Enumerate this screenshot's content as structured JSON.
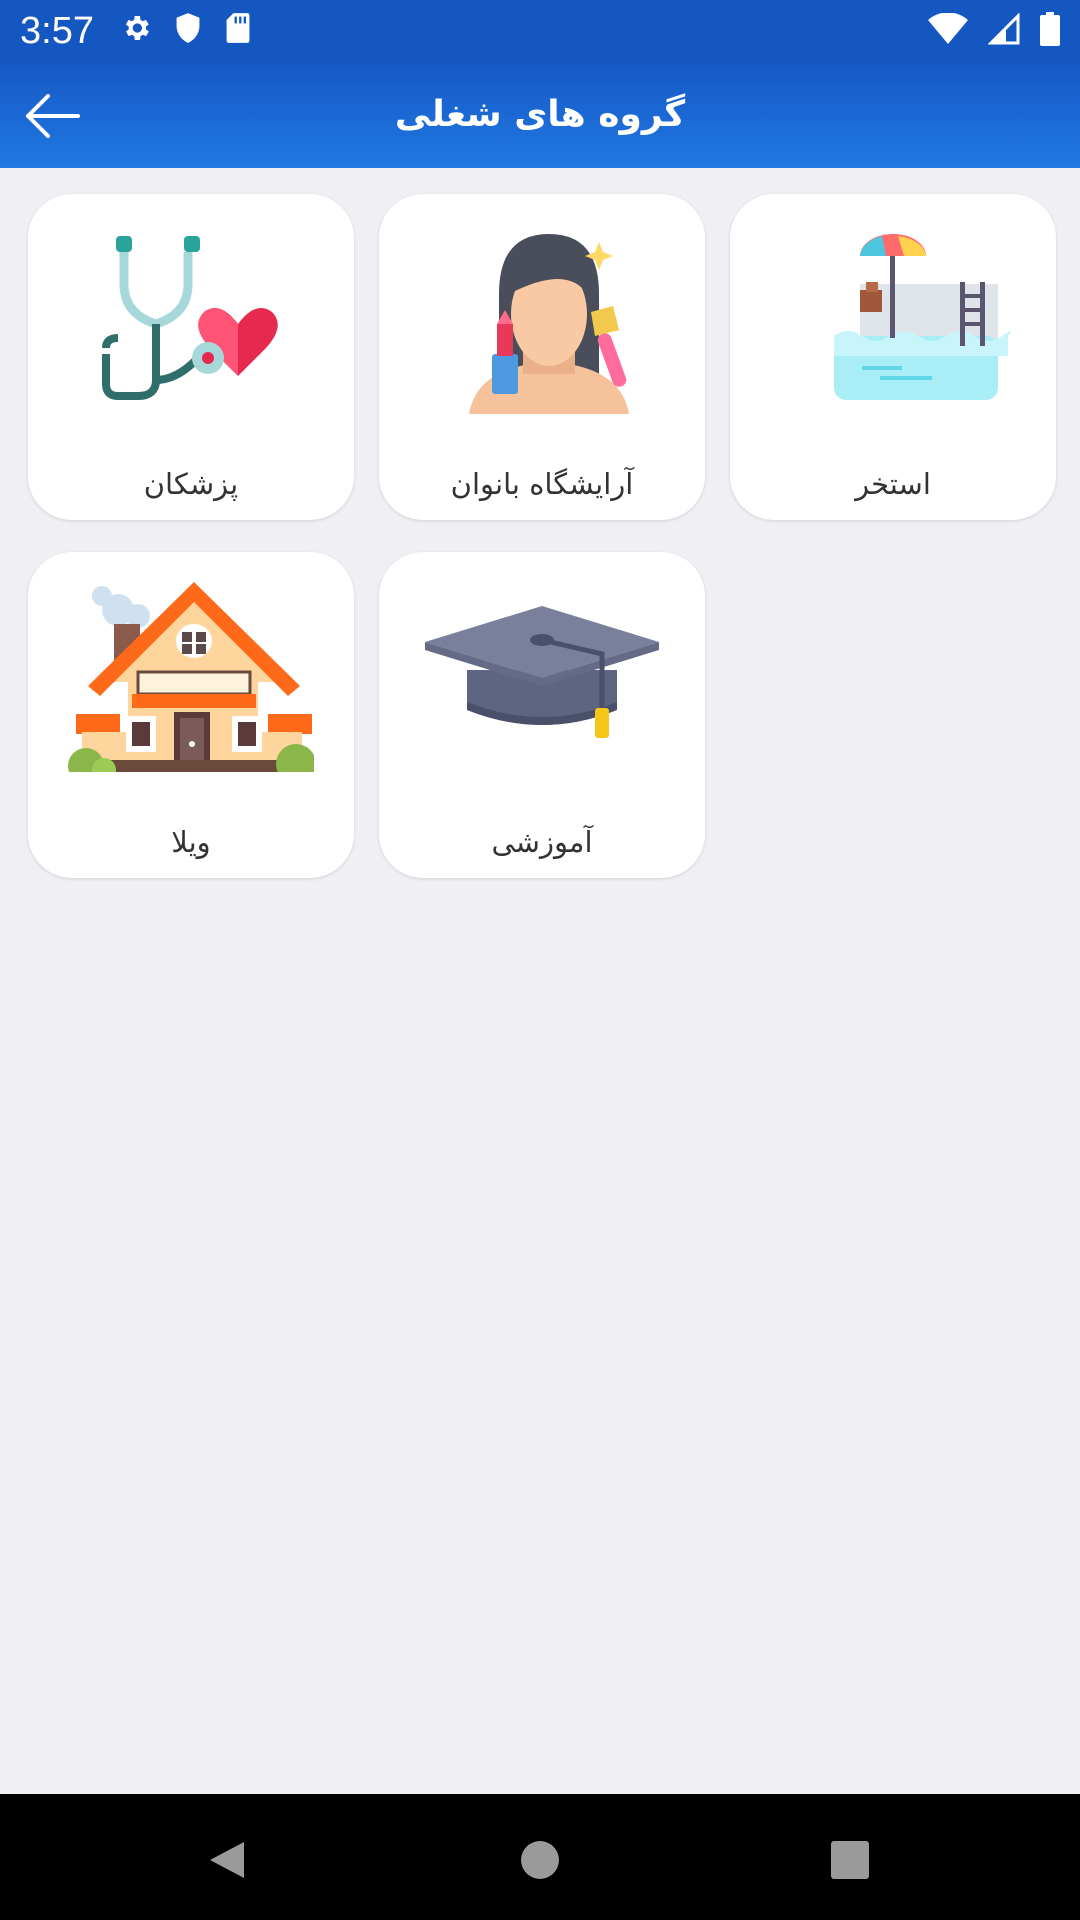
{
  "status_bar": {
    "time": "3:57",
    "icons_left": [
      "gear-icon",
      "shield-icon",
      "sd-card-icon"
    ],
    "icons_right": [
      "wifi-icon",
      "signal-icon",
      "battery-icon"
    ]
  },
  "app_bar": {
    "title": "گروه های شغلی",
    "back_icon": "arrow-left-icon"
  },
  "categories": [
    {
      "label": "استخر",
      "icon": "pool-icon"
    },
    {
      "label": "آرایشگاه بانوان",
      "icon": "beauty-salon-icon"
    },
    {
      "label": "پزشکان",
      "icon": "stethoscope-heart-icon"
    },
    {
      "label": "آموزشی",
      "icon": "graduation-cap-icon"
    },
    {
      "label": "ویلا",
      "icon": "villa-house-icon"
    }
  ],
  "nav_bar": {
    "buttons": [
      "back-triangle-icon",
      "home-circle-icon",
      "recents-square-icon"
    ]
  },
  "colors": {
    "status_bar": "#1457c0",
    "app_bar_top": "#1659c6",
    "app_bar_bottom": "#2178e3",
    "background": "#efeff4",
    "card": "#ffffff"
  }
}
